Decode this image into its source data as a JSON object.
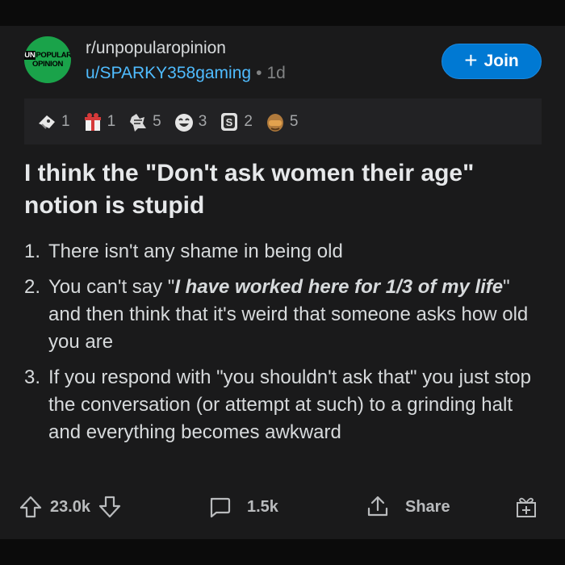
{
  "community": {
    "logo_line1_prefix": "UN",
    "logo_line1_rest": "POPULAR",
    "logo_line2": "OPINION",
    "name": "r/unpopularopinion"
  },
  "post": {
    "author": "u/SPARKY358gaming",
    "separator": "•",
    "age": "1d",
    "join_label": "Join",
    "title": "I think the \"Don't ask women their age\" notion is stupid",
    "awards": [
      {
        "icon": "wholesome-award-icon",
        "count": "1"
      },
      {
        "icon": "gift-award-icon",
        "count": "1"
      },
      {
        "icon": "sweet-award-icon",
        "count": "5"
      },
      {
        "icon": "laughing-award-icon",
        "count": "3"
      },
      {
        "icon": "coin-award-icon",
        "count": "2"
      },
      {
        "icon": "facepalm-award-icon",
        "count": "5"
      }
    ],
    "body": {
      "item1": {
        "num": "1.",
        "text": "There isn't any shame in being old"
      },
      "item2": {
        "num": "2.",
        "pre": "You can't say \"",
        "emph": "I have worked here for 1/3 of my life",
        "post": "\" and then think that it's weird that someone asks how old you are"
      },
      "item3": {
        "num": "3.",
        "text": "If you respond with \"you shouldn't ask that\" you just stop the conversation (or attempt at such) to a grinding halt and everything becomes awkward"
      }
    },
    "votes": "23.0k",
    "comments": "1.5k",
    "share_label": "Share"
  },
  "colors": {
    "background": "#121212",
    "card": "#1a1a1b",
    "accent": "#0079d3",
    "link": "#4fbcff",
    "logo_green": "#1aa34a"
  }
}
